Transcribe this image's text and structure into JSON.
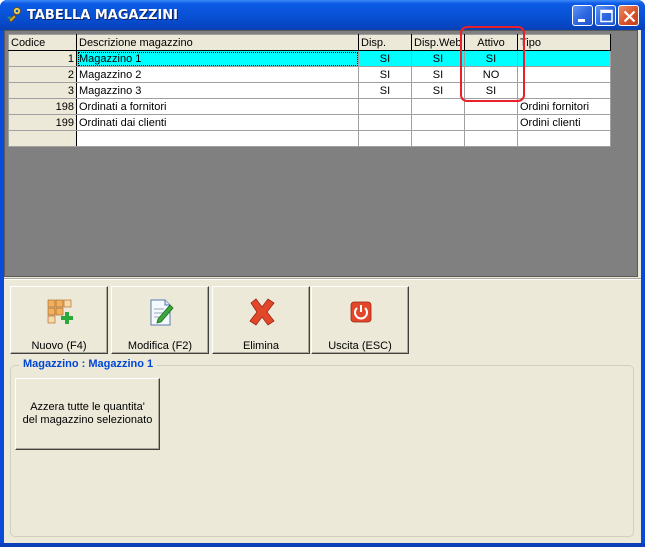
{
  "window": {
    "title": "TABELLA MAGAZZINI",
    "icon": "magazzini-app-icon"
  },
  "grid": {
    "columns": [
      "Codice",
      "Descrizione magazzino",
      "Disp.",
      "Disp.Web",
      "Attivo",
      "Tipo"
    ],
    "rows": [
      {
        "codice": "1",
        "descrizione": "Magazzino 1",
        "disp": "SI",
        "disp_web": "SI",
        "attivo": "SI",
        "tipo": ""
      },
      {
        "codice": "2",
        "descrizione": "Magazzino 2",
        "disp": "SI",
        "disp_web": "SI",
        "attivo": "NO",
        "tipo": ""
      },
      {
        "codice": "3",
        "descrizione": "Magazzino 3",
        "disp": "SI",
        "disp_web": "SI",
        "attivo": "SI",
        "tipo": ""
      },
      {
        "codice": "198",
        "descrizione": "Ordinati a fornitori",
        "disp": "",
        "disp_web": "",
        "attivo": "",
        "tipo": "Ordini fornitori"
      },
      {
        "codice": "199",
        "descrizione": "Ordinati dai clienti",
        "disp": "",
        "disp_web": "",
        "attivo": "",
        "tipo": "Ordini clienti"
      }
    ],
    "selected_row": 0,
    "selection_color": "#00ffff"
  },
  "toolbar": {
    "new_label": "Nuovo (F4)",
    "edit_label": "Modifica (F2)",
    "delete_label": "Elimina",
    "exit_label": "Uscita (ESC)"
  },
  "group": {
    "title": "Magazzino : Magazzino 1",
    "reset_label": "Azzera tutte le quantita' del magazzino selezionato"
  },
  "colors": {
    "annotation": "#e8202a",
    "group_title": "#0046d5"
  }
}
